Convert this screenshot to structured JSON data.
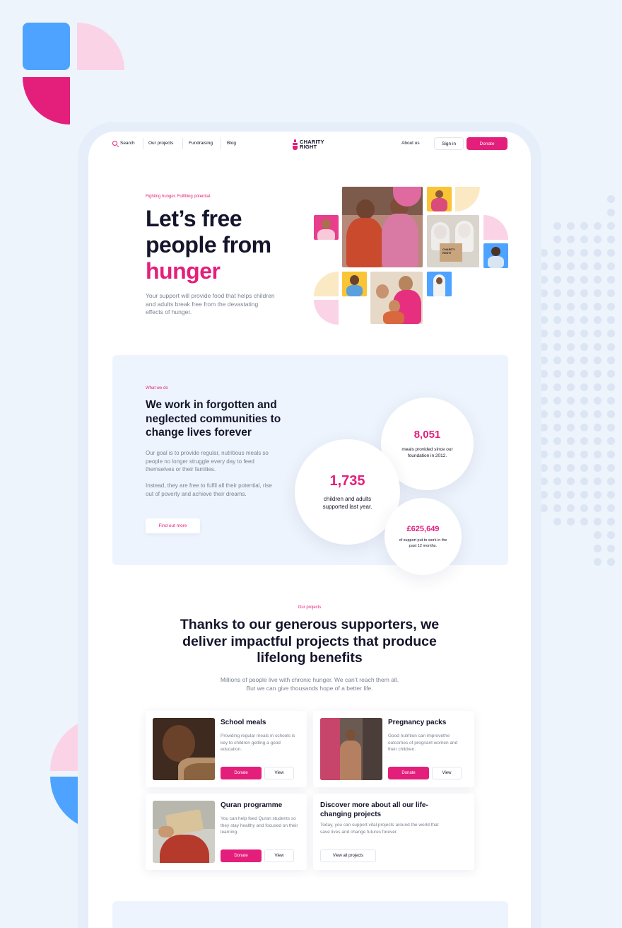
{
  "nav": {
    "search_label": "Search",
    "items": [
      "Our projects",
      "Fundraising",
      "Blog"
    ],
    "logo_line1": "CHARITY",
    "logo_line2": "RIGHT",
    "about_label": "About us",
    "signin_label": "Sign in",
    "donate_label": "Donate"
  },
  "hero": {
    "eyebrow": "Fighting hunger. Fulfilling potential.",
    "title_line1": "Let’s free",
    "title_line2": "people from",
    "title_accent": "hunger",
    "text": "Your support will provide food that helps children and adults break free from the devastating effects of hunger."
  },
  "what_we_do": {
    "eyebrow": "What we do",
    "title": "We work in forgotten and neglected communities to change lives forever",
    "paragraph1": "Our goal is to provide regular, nutritious meals so people no longer struggle every day to feed themselves or their families.",
    "paragraph2": "Instead, they are free to fulfil all their potential, rise out of poverty and  achieve their dreams.",
    "cta_label": "Find out more",
    "stats": [
      {
        "value": "8,051",
        "label": "meals provided since our foundation in 2012."
      },
      {
        "value": "1,735",
        "label": "children and adults supported last year."
      },
      {
        "value": "£625,649",
        "label": "of support put to work in the past 12 months."
      }
    ]
  },
  "projects": {
    "eyebrow": "Our projects",
    "title": "Thanks to our generous supporters, we deliver impactful projects that produce lifelong benefits",
    "text": "Millions of people live with chronic hunger. We can’t reach them all. But we can give thousands hope of a better life.",
    "cards": [
      {
        "title": "School meals",
        "text": "Providing regular meals in schools is key to children getting a good education.",
        "donate_label": "Donate",
        "view_label": "View"
      },
      {
        "title": "Pregnancy packs",
        "text": "Good nutrition can improvethe outcomes of pregnant women and their children.",
        "donate_label": "Donate",
        "view_label": "View"
      },
      {
        "title": "Quran programme",
        "text": "You can help feed Quran students so they stay healthy and focused on their learning.",
        "donate_label": "Donate",
        "view_label": "View"
      }
    ],
    "discover": {
      "title": "Discover more about all our life-changing projects",
      "text": "Today, you can support vital projects around the world that save lives and change futures forever.",
      "button_label": "View all projects"
    }
  },
  "colors": {
    "accent": "#e41f7b",
    "blue": "#4da3ff",
    "pink_light": "#fbd3e6",
    "yellow": "#f9d54a",
    "cream": "#fbe9c4"
  }
}
